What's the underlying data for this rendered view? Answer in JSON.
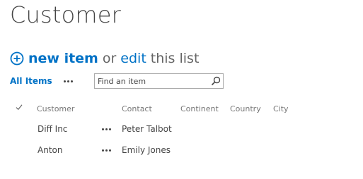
{
  "page": {
    "title": "Customer"
  },
  "commands": {
    "new_item": "new item",
    "or": "or",
    "edit": "edit",
    "this_list": "this list"
  },
  "views": {
    "all_items": "All Items"
  },
  "search": {
    "placeholder": "Find an item"
  },
  "columns": [
    "Customer",
    "Contact",
    "Continent",
    "Country",
    "City"
  ],
  "rows": [
    {
      "customer": "Diff Inc",
      "contact": "Peter Talbot",
      "continent": "",
      "country": "",
      "city": ""
    },
    {
      "customer": "Anton",
      "contact": "Emily Jones",
      "continent": "",
      "country": "",
      "city": ""
    }
  ],
  "colors": {
    "accent": "#0072c6",
    "text": "#444444",
    "muted": "#777777"
  },
  "icons": [
    "add-circle-icon",
    "ellipsis-icon",
    "search-icon",
    "checkmark-icon"
  ]
}
